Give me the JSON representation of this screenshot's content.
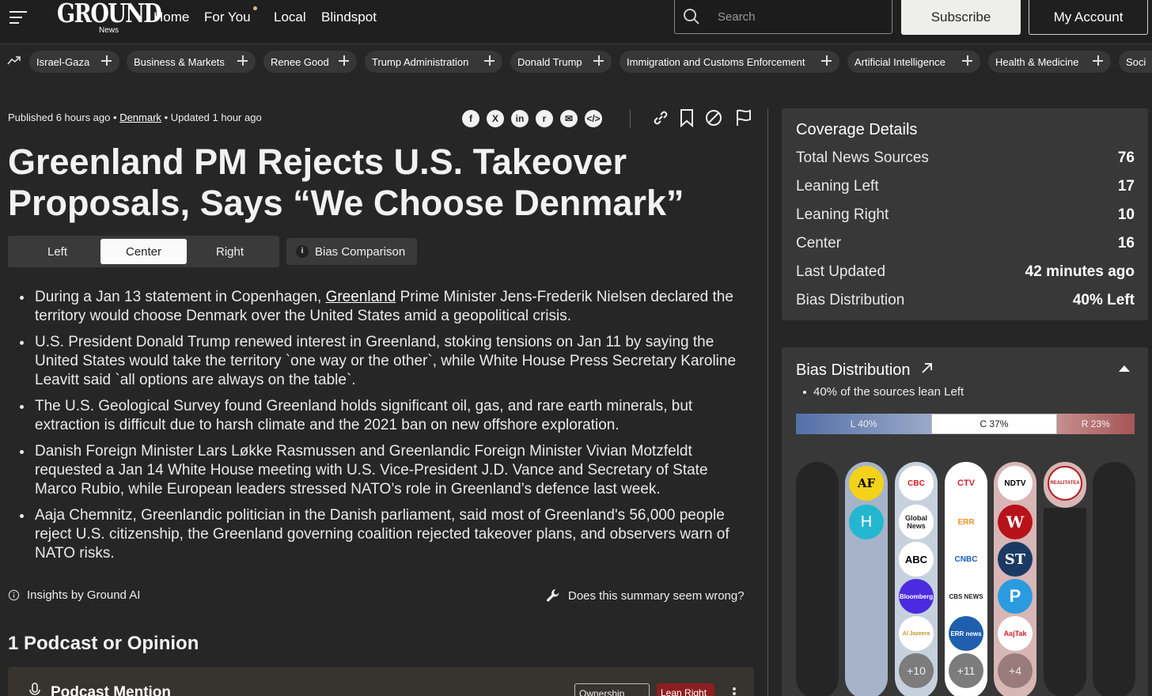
{
  "nav": {
    "logo": "GROUND",
    "logo_sub": "News",
    "links": [
      "Home",
      "For You",
      "Local",
      "Blindspot"
    ],
    "search_placeholder": "Search",
    "subscribe": "Subscribe",
    "account": "My Account"
  },
  "topics": [
    "Israel-Gaza",
    "Business & Markets",
    "Renee Good",
    "Trump Administration",
    "Donald Trump",
    "Immigration and Customs Enforcement",
    "Artificial Intelligence",
    "Health & Medicine",
    "Soci"
  ],
  "article": {
    "published": "Published 6 hours ago",
    "dot": "•",
    "location": "Denmark",
    "updated": "Updated 1 hour ago",
    "headline": "Greenland PM Rejects U.S. Takeover Proposals, Says “We Choose Denmark”",
    "tabs": [
      "Left",
      "Center",
      "Right"
    ],
    "active_tab": "Center",
    "bias_comparison": "Bias Comparison",
    "bullets": [
      {
        "pre": "During a Jan 13 statement in Copenhagen, ",
        "link": "Greenland",
        "post": " Prime Minister Jens-Frederik Nielsen declared the territory would choose Denmark over the United States amid a geopolitical crisis."
      },
      {
        "pre": "U.S. President Donald Trump renewed interest in Greenland, stoking tensions on Jan 11 by saying the United States would take the territory `one way or the other`, while White House Press Secretary Karoline Leavitt said `all options are always on the table`.",
        "link": "",
        "post": ""
      },
      {
        "pre": "The U.S. Geological Survey found Greenland holds significant oil, gas, and rare earth minerals, but extraction is difficult due to harsh climate and the 2021 ban on new offshore exploration.",
        "link": "",
        "post": ""
      },
      {
        "pre": "Danish Foreign Minister Lars Løkke Rasmussen and Greenlandic Foreign Minister Vivian Motzfeldt requested a Jan 14 White House meeting with U.S. Vice-President J.D. Vance and Secretary of State Marco Rubio, while European leaders stressed NATO’s role in Greenland’s defence last week.",
        "link": "",
        "post": ""
      },
      {
        "pre": "Aaja Chemnitz, Greenlandic politician in the Danish parliament, said most of Greenland's 56,000 people reject U.S. citizenship, the Greenland governing coalition rejected takeover plans, and observers warn of NATO risks.",
        "link": "",
        "post": ""
      }
    ],
    "insights": "Insights by Ground AI",
    "wrong": "Does this summary seem wrong?",
    "section_title": "1 Podcast or Opinion",
    "podcast_title": "Podcast Mention",
    "ownership": "Ownership",
    "lean_tag": "Lean Right"
  },
  "coverage": {
    "title": "Coverage Details",
    "rows": [
      {
        "label": "Total News Sources",
        "value": "76"
      },
      {
        "label": "Leaning Left",
        "value": "17"
      },
      {
        "label": "Leaning Right",
        "value": "10"
      },
      {
        "label": "Center",
        "value": "16"
      },
      {
        "label": "Last Updated",
        "value": "42 minutes ago"
      },
      {
        "label": "Bias Distribution",
        "value": "40% Left"
      }
    ]
  },
  "bias_distribution": {
    "title": "Bias Distribution",
    "bullet": "40% of the sources lean Left",
    "segments": [
      {
        "label": "L 40%",
        "share": 40
      },
      {
        "label": "C 37%",
        "share": 37
      },
      {
        "label": "R 23%",
        "share": 23
      }
    ],
    "columns": [
      {
        "sources": []
      },
      {
        "sources": [
          "AF",
          "H"
        ]
      },
      {
        "sources": [
          "CBC",
          "Global News",
          "ABC",
          "Bloomberg",
          "Al Jazeera"
        ],
        "more": "+10"
      },
      {
        "sources": [
          "CTV",
          "ERR",
          "CNBC",
          "CBS NEWS",
          "ERR news"
        ],
        "more": "+11"
      },
      {
        "sources": [
          "NDTV",
          "W",
          "ST",
          "P",
          "AajTak"
        ],
        "more": "+4"
      },
      {
        "sources": [
          "REALITATEA"
        ]
      },
      {
        "sources": []
      }
    ]
  },
  "colors": {
    "background": "#262626",
    "panel": "#383838",
    "left": "#5470a8",
    "right": "#a65555",
    "lean_right_tag": "#8c1f1f"
  }
}
